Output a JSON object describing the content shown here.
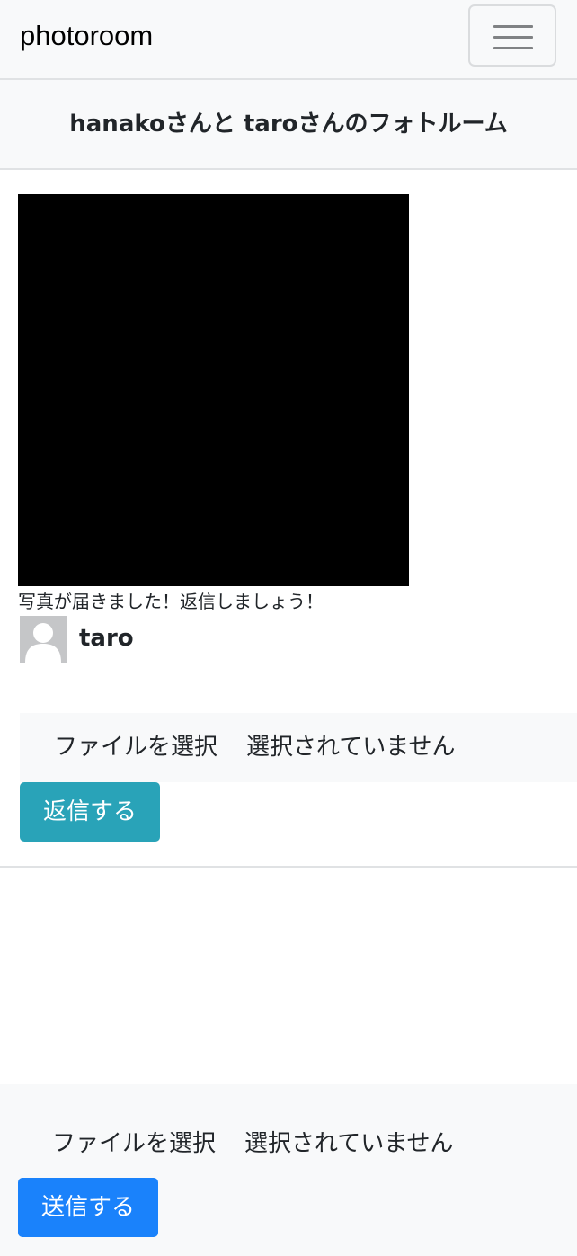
{
  "navbar": {
    "brand": "photoroom",
    "toggler_icon": "hamburger-menu-icon"
  },
  "room": {
    "title": "hanakoさんと taroさんのフォトルーム"
  },
  "message": {
    "caption": "写真が届きました！返信しましょう！",
    "sender_name": "taro",
    "avatar_icon": "default-user-avatar-icon",
    "reply_form": {
      "file_button_label": "ファイルを選択",
      "file_status": "選択されていません",
      "submit_label": "返信する"
    }
  },
  "footer_form": {
    "file_button_label": "ファイルを選択",
    "file_status": "選択されていません",
    "submit_label": "送信する"
  },
  "colors": {
    "reply_button": "#29a3b8",
    "send_button": "#1a82fb",
    "panel_background": "#f8f9fa"
  }
}
